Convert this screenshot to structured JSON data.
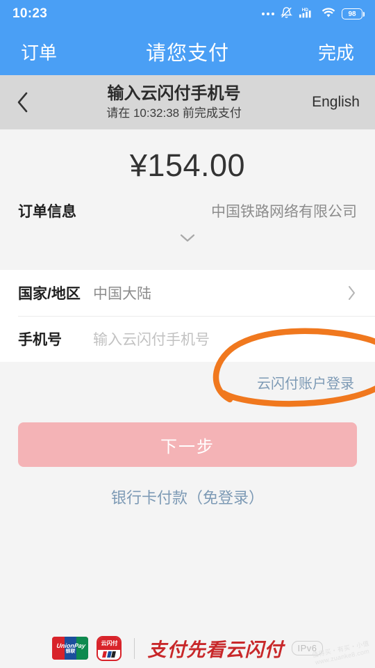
{
  "status_bar": {
    "time": "10:23",
    "battery_level": "98",
    "icons": [
      "more-dots-icon",
      "bell-muted-icon",
      "hd-signal-icon",
      "wifi-icon",
      "battery-icon"
    ]
  },
  "navbar": {
    "left_label": "订单",
    "title": "请您支付",
    "right_label": "完成",
    "color": "#4a9ff5"
  },
  "subheader": {
    "back_icon": "chevron-left-icon",
    "title": "输入云闪付手机号",
    "subtitle": "请在 10:32:38 前完成支付",
    "language_label": "English",
    "background": "#d7d7d7"
  },
  "amount_card": {
    "amount": "¥154.00",
    "order_label": "订单信息",
    "order_value": "中国铁路网络有限公司",
    "expand_icon": "chevron-down-icon"
  },
  "form": {
    "rows": [
      {
        "label": "国家/地区",
        "value": "中国大陆",
        "placeholder": "",
        "chevron": "chevron-right-icon"
      },
      {
        "label": "手机号",
        "value": "",
        "placeholder": "输入云闪付手机号",
        "chevron": ""
      }
    ]
  },
  "links": {
    "account_login": "云闪付账户登录",
    "card_pay": "银行卡付款（免登录）"
  },
  "actions": {
    "next_label": "下一步",
    "next_disabled_color": "#f4b3b6"
  },
  "annotation": {
    "type": "hand-drawn-ellipse",
    "color": "#f0781e",
    "target": "云闪付账户登录"
  },
  "footer": {
    "unionpay_logo_text": "UnionPay",
    "unionpay_logo_sub": "银联",
    "app_icon_text": "云闪付",
    "slogan": "支付先看云闪付",
    "ipv6_badge": "IPv6",
    "watermark_line1": "值得买・有买・小值",
    "watermark_line2": "www.zuanke8.com"
  }
}
